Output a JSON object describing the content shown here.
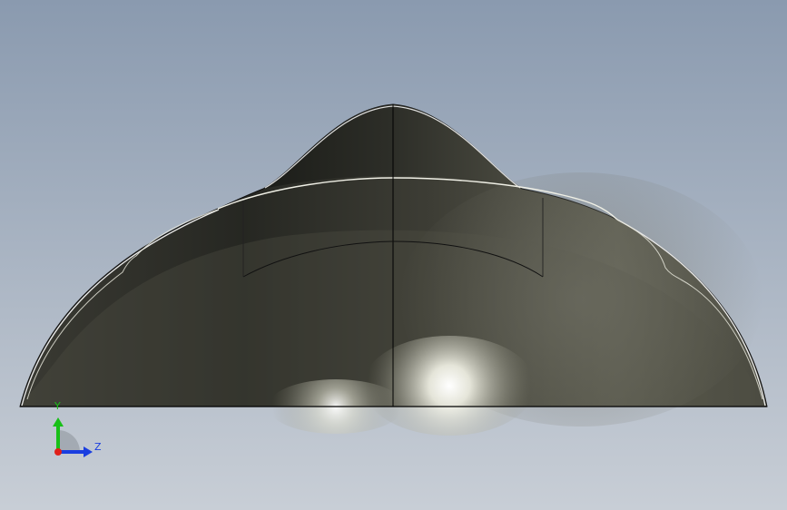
{
  "viewport": {
    "background": {
      "top_color": "#8a9aaf",
      "bottom_color": "#c8ced6"
    },
    "model": {
      "name": "dome-shell-part",
      "body_color": "#5c5c50",
      "shadow_color": "#1a1b17",
      "highlight_color": "#ffffff",
      "edge_color": "#000000"
    }
  },
  "triad": {
    "y_label": "Y",
    "z_label": "Z",
    "colors": {
      "x": "#e0201a",
      "y": "#18c018",
      "z": "#1a3ee0"
    }
  }
}
